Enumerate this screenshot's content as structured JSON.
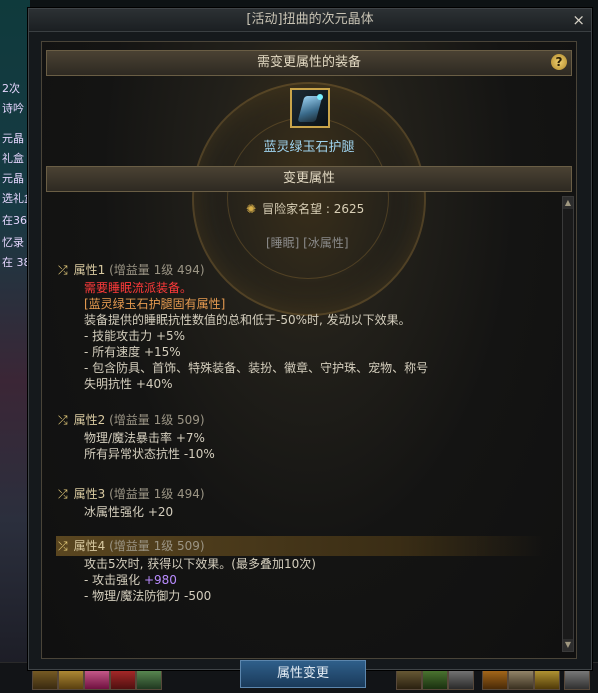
{
  "window": {
    "title": "[活动]扭曲的次元晶体",
    "close": "×"
  },
  "section1": {
    "title": "需变更属性的装备",
    "help": "?"
  },
  "item": {
    "name": "蓝灵绿玉石护腿"
  },
  "section2": {
    "title": "变更属性"
  },
  "fame": {
    "label": "冒险家名望 : 2625"
  },
  "tags": "[睡眠] [冰属性]",
  "attributes": [
    {
      "name": "属性1",
      "gain": "(增益量 1级 494)",
      "lines": [
        {
          "text": "需要睡眠流派装备。",
          "color": "red"
        },
        {
          "text": "[蓝灵绿玉石护腿固有属性]",
          "color": "orange"
        },
        {
          "text": "装备提供的睡眠抗性数值的总和低于-50%时, 发动以下效果。"
        },
        {
          "text": "- 技能攻击力 +5%"
        },
        {
          "text": "- 所有速度 +15%"
        },
        {
          "text": "- 包含防具、首饰、特殊装备、装扮、徽章、守护珠、宠物、称号"
        },
        {
          "text": "失明抗性 +40%"
        }
      ]
    },
    {
      "name": "属性2",
      "gain": "(增益量 1级 509)",
      "lines": [
        {
          "text": "物理/魔法暴击率 +7%"
        },
        {
          "text": "所有异常状态抗性 -10%"
        }
      ]
    },
    {
      "name": "属性3",
      "gain": "(增益量 1级 494)",
      "lines": [
        {
          "text": "冰属性强化 +20"
        }
      ]
    },
    {
      "name": "属性4",
      "gain": "(增益量 1级 509)",
      "lines": [
        {
          "text": "攻击5次时, 获得以下效果。(最多叠加10次)"
        },
        {
          "text": "- 攻击强化 ",
          "value": "+980"
        },
        {
          "text": "- 物理/魔法防御力 -500"
        }
      ]
    }
  ],
  "button": {
    "label": "属性变更"
  },
  "background": {
    "left_fragments": [
      "2次",
      "诗吟",
      "元晶",
      "礼盒",
      "元晶",
      "选礼盒",
      "在36",
      "忆录",
      "在 38"
    ]
  },
  "colors": {
    "accent": "#c9a44a",
    "item_name": "#9fd4ef",
    "red": "#ff3a3a",
    "orange": "#e69b50",
    "purple": "#b98cff"
  }
}
